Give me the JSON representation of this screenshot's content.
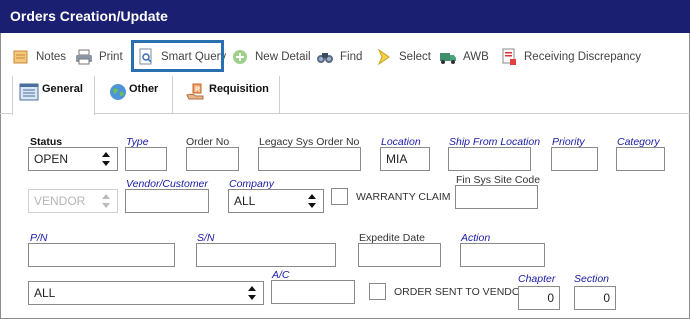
{
  "window": {
    "title": "Orders Creation/Update"
  },
  "toolbar": {
    "notes": "Notes",
    "print": "Print",
    "smart_query": "Smart Query",
    "new_detail": "New Detail",
    "find": "Find",
    "select": "Select",
    "awb": "AWB",
    "receiving_discrepancy": "Receiving Discrepancy"
  },
  "tabs": {
    "general": "General",
    "other": "Other",
    "requisition": "Requisition"
  },
  "form": {
    "status": {
      "label": "Status",
      "value": "OPEN"
    },
    "type": {
      "label": "Type",
      "value": ""
    },
    "order_no": {
      "label": "Order No",
      "value": ""
    },
    "legacy_sys_order_no": {
      "label": "Legacy Sys Order No",
      "value": ""
    },
    "location": {
      "label": "Location",
      "value": "MIA"
    },
    "ship_from_location": {
      "label": "Ship From Location",
      "value": ""
    },
    "priority": {
      "label": "Priority",
      "value": ""
    },
    "category": {
      "label": "Category",
      "value": ""
    },
    "vendor_type": {
      "value": "VENDOR"
    },
    "vendor_customer": {
      "label": "Vendor/Customer",
      "value": ""
    },
    "company": {
      "label": "Company",
      "value": "ALL"
    },
    "warranty_claim": {
      "label": "WARRANTY CLAIM",
      "checked": false
    },
    "fin_sys_site_code": {
      "label": "Fin Sys Site Code",
      "value": ""
    },
    "pn": {
      "label": "P/N",
      "value": ""
    },
    "sn": {
      "label": "S/N",
      "value": ""
    },
    "expedite_date": {
      "label": "Expedite Date",
      "value": ""
    },
    "action": {
      "label": "Action",
      "value": ""
    },
    "bottom_select": {
      "value": "ALL"
    },
    "ac": {
      "label": "A/C",
      "value": ""
    },
    "order_sent_to_vendor": {
      "label": "ORDER SENT TO VENDOR",
      "checked": false
    },
    "chapter": {
      "label": "Chapter",
      "value": "0"
    },
    "section": {
      "label": "Section",
      "value": "0"
    }
  }
}
